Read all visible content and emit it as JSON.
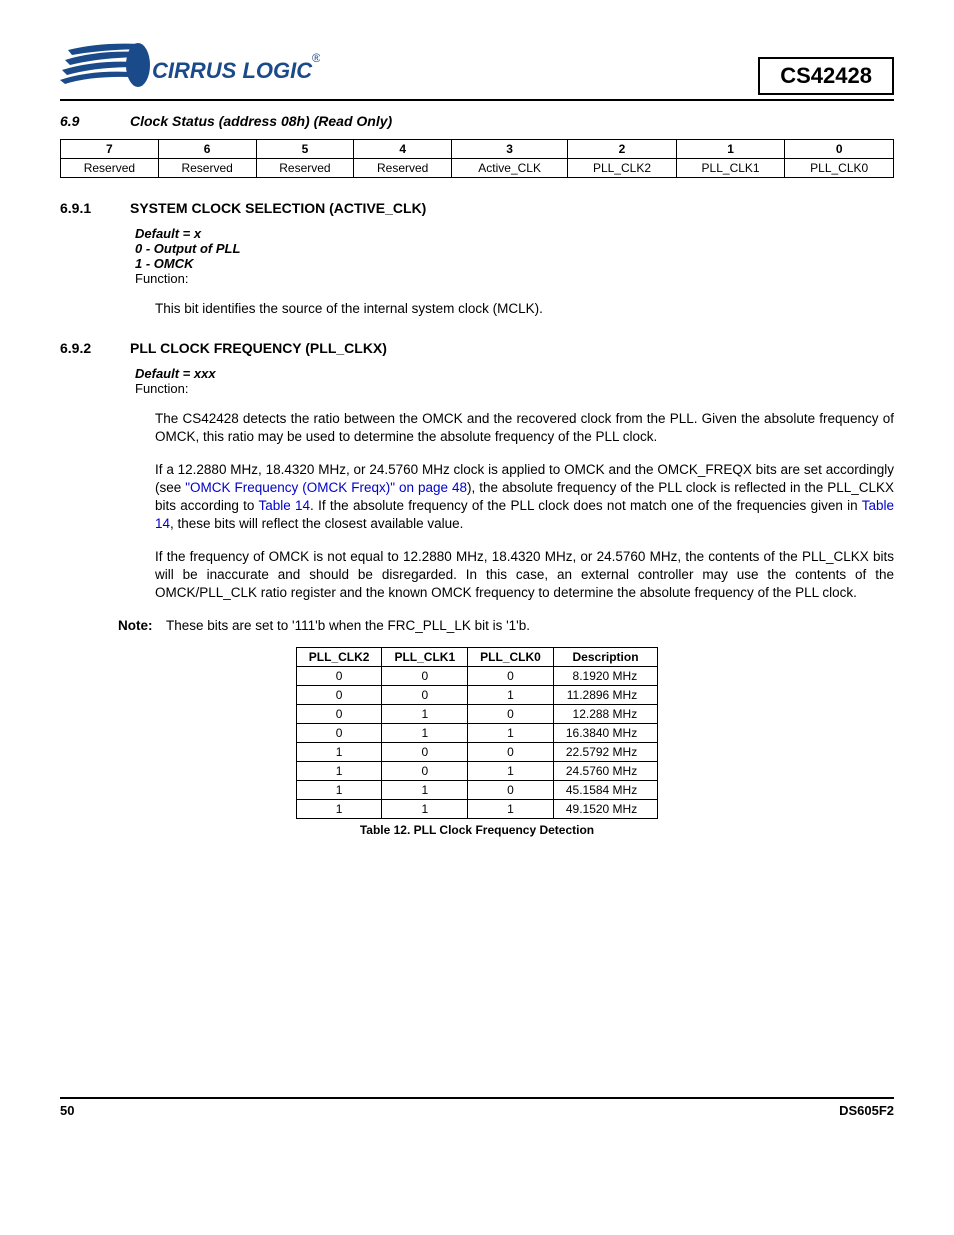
{
  "header": {
    "logo_text": "CIRRUS LOGIC",
    "partnum": "CS42428"
  },
  "section": {
    "num": "6.9",
    "title": "Clock Status (address 08h) (Read Only)"
  },
  "bit_table": {
    "headers": [
      "7",
      "6",
      "5",
      "4",
      "3",
      "2",
      "1",
      "0"
    ],
    "cells": [
      "Reserved",
      "Reserved",
      "Reserved",
      "Reserved",
      "Active_CLK",
      "PLL_CLK2",
      "PLL_CLK1",
      "PLL_CLK0"
    ]
  },
  "sub1": {
    "num": "6.9.1",
    "title": "SYSTEM CLOCK SELECTION (ACTIVE_CLK)",
    "default": "Default = x",
    "line0": "0 - Output of PLL",
    "line1": "1 - OMCK",
    "func": "Function:",
    "body": "This bit identifies the source of the internal system clock (MCLK)."
  },
  "sub2": {
    "num": "6.9.2",
    "title": "PLL CLOCK FREQUENCY (PLL_CLKX)",
    "default": "Default = xxx",
    "func": "Function:",
    "p1": "The CS42428 detects the ratio between the OMCK and the recovered clock from the PLL. Given the absolute frequency of OMCK, this ratio may be used to determine the absolute frequency of the PLL clock.",
    "p2a": "If a 12.2880 MHz, 18.4320 MHz, or 24.5760 MHz clock is applied to OMCK and the OMCK_FREQX bits are set accordingly (see ",
    "p2link1": "\"OMCK Frequency (OMCK Freqx)\" on page 48",
    "p2b": "), the absolute frequency of the PLL clock is reflected in the PLL_CLKX bits according to ",
    "p2link2": "Table 14",
    "p2c": ". If the absolute frequency of the PLL clock does not match one of the frequencies given in ",
    "p2link3": "Table 14",
    "p2d": ", these bits will reflect the closest available value.",
    "p3": "If the frequency of OMCK is not equal to 12.2880 MHz, 18.4320 MHz, or 24.5760 MHz, the contents of the PLL_CLKX bits will be inaccurate and should be disregarded. In this case, an external controller may use the contents of the OMCK/PLL_CLK ratio register and the known OMCK frequency to determine the absolute frequency of the PLL clock."
  },
  "note": {
    "label": "Note:",
    "text": "These bits are set to '111'b when the FRC_PLL_LK bit is '1'b."
  },
  "freq_table": {
    "headers": [
      "PLL_CLK2",
      "PLL_CLK1",
      "PLL_CLK0",
      "Description"
    ],
    "rows": [
      [
        "0",
        "0",
        "0",
        "8.1920 MHz"
      ],
      [
        "0",
        "0",
        "1",
        "11.2896 MHz"
      ],
      [
        "0",
        "1",
        "0",
        "12.288 MHz"
      ],
      [
        "0",
        "1",
        "1",
        "16.3840 MHz"
      ],
      [
        "1",
        "0",
        "0",
        "22.5792 MHz"
      ],
      [
        "1",
        "0",
        "1",
        "24.5760 MHz"
      ],
      [
        "1",
        "1",
        "0",
        "45.1584 MHz"
      ],
      [
        "1",
        "1",
        "1",
        "49.1520 MHz"
      ]
    ],
    "caption": "Table 12. PLL Clock Frequency Detection"
  },
  "footer": {
    "page": "50",
    "doc": "DS605F2"
  }
}
